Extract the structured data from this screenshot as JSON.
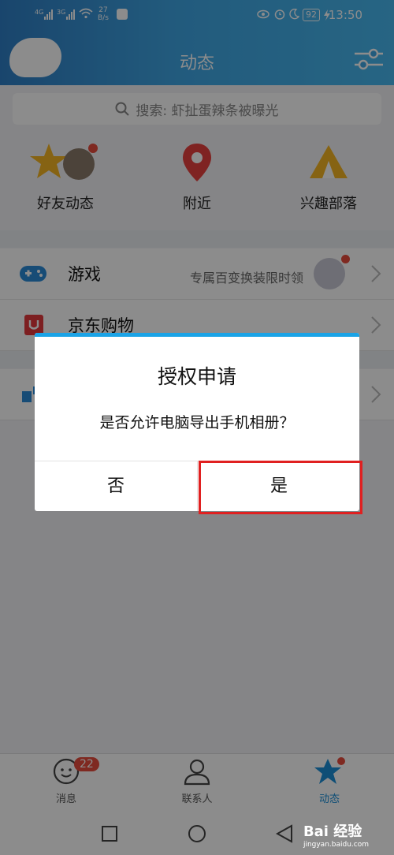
{
  "status": {
    "net1": "4G",
    "net2": "3G",
    "speed_top": "27",
    "speed_bottom": "B/s",
    "battery": "92",
    "time": "13:50"
  },
  "header": {
    "title": "动态"
  },
  "search": {
    "placeholder": "搜索: 虾扯蛋辣条被曝光"
  },
  "entries": [
    {
      "label": "好友动态",
      "icon": "friend-feed-icon"
    },
    {
      "label": "附近",
      "icon": "location-pin-icon"
    },
    {
      "label": "兴趣部落",
      "icon": "tribe-tent-icon"
    }
  ],
  "rows": [
    {
      "title": "游戏",
      "subtitle": "专属百变换装限时领",
      "icon": "gamepad-icon"
    },
    {
      "title": "京东购物",
      "icon": "jd-shopping-icon"
    }
  ],
  "dialog": {
    "title": "授权申请",
    "message": "是否允许电脑导出手机相册？",
    "no_label": "否",
    "yes_label": "是"
  },
  "tabs": [
    {
      "label": "消息",
      "badge": "22",
      "icon": "message-bubble-icon"
    },
    {
      "label": "联系人",
      "icon": "contact-person-icon"
    },
    {
      "label": "动态",
      "icon": "star-icon",
      "active": true
    }
  ],
  "watermark": {
    "brand": "Bai 经验",
    "url": "jingyan.baidu.com"
  },
  "colors": {
    "accent": "#1aa3e6",
    "highlight": "#e02020",
    "badge": "#e74c3c"
  }
}
